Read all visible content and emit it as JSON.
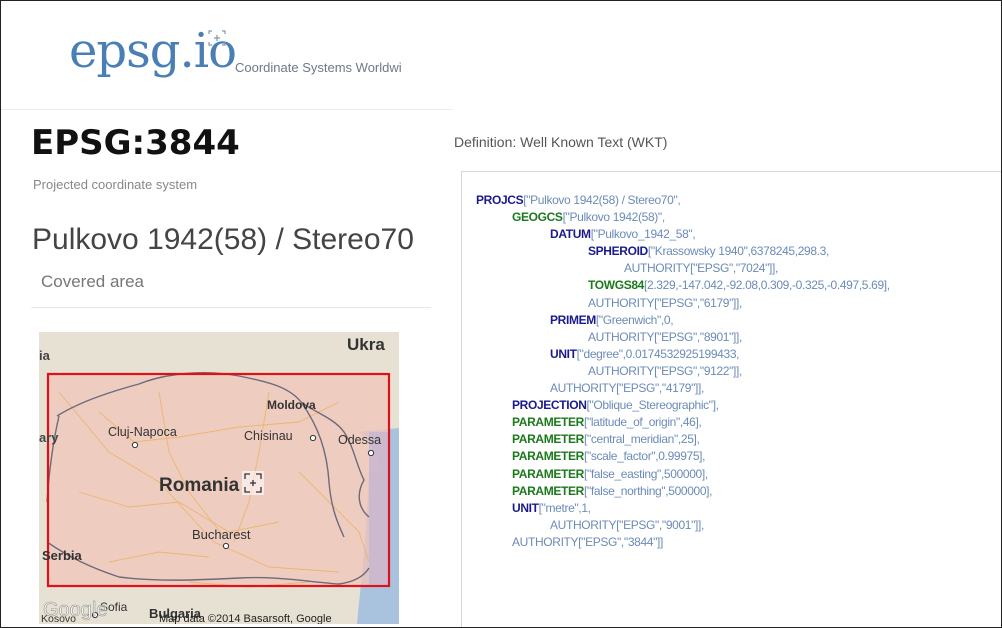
{
  "site": {
    "logo": "epsg.io",
    "tagline": "Coordinate Systems Worldwi"
  },
  "crs": {
    "code": "EPSG:3844",
    "kind": "Projected coordinate system",
    "name": "Pulkovo 1942(58) / Stereo70",
    "covered_area_label": "Covered area"
  },
  "map": {
    "labels": {
      "ukraine": "Ukra",
      "moldova": "Moldova",
      "cluj": "Cluj-Napoca",
      "chisinau": "Chisinau",
      "odessa": "Odessa",
      "romania": "Romania",
      "bucharest": "Bucharest",
      "serbia": "Serbia",
      "sofia": "Sofia",
      "bulgaria": "Bulgaria",
      "kosovo": "Kosovo",
      "left_edge_top": "ia",
      "left_edge_mid": "ary",
      "google": "Google",
      "attribution": "Map data ©2014 Basarsoft, Google"
    },
    "colors": {
      "bbox": "#e0101a",
      "bbox_fill": "#f2c6bd",
      "sea": "#a6c1de"
    }
  },
  "definition": {
    "title": "Definition: Well Known Text (WKT)",
    "lines": [
      {
        "indent": 0,
        "kw": "PROJCS",
        "kwcolor": "navy",
        "rest": "[\"Pulkovo 1942(58) / Stereo70\","
      },
      {
        "indent": 36,
        "kw": "GEOGCS",
        "kwcolor": "green",
        "rest": "[\"Pulkovo 1942(58)\","
      },
      {
        "indent": 74,
        "kw": "DATUM",
        "kwcolor": "navy",
        "rest": "[\"Pulkovo_1942_58\","
      },
      {
        "indent": 112,
        "kw": "SPHEROID",
        "kwcolor": "navy",
        "rest": "[\"Krassowsky 1940\",6378245,298.3,"
      },
      {
        "indent": 148,
        "kw": "",
        "kwcolor": "",
        "rest": "AUTHORITY[\"EPSG\",\"7024\"]],"
      },
      {
        "indent": 112,
        "kw": "TOWGS84",
        "kwcolor": "green",
        "rest": "[2.329,-147.042,-92.08,0.309,-0.325,-0.497,5.69],"
      },
      {
        "indent": 112,
        "kw": "",
        "kwcolor": "",
        "rest": "AUTHORITY[\"EPSG\",\"6179\"]],"
      },
      {
        "indent": 74,
        "kw": "PRIMEM",
        "kwcolor": "navy",
        "rest": "[\"Greenwich\",0,"
      },
      {
        "indent": 112,
        "kw": "",
        "kwcolor": "",
        "rest": "AUTHORITY[\"EPSG\",\"8901\"]],"
      },
      {
        "indent": 74,
        "kw": "UNIT",
        "kwcolor": "navy",
        "rest": "[\"degree\",0.0174532925199433,"
      },
      {
        "indent": 112,
        "kw": "",
        "kwcolor": "",
        "rest": "AUTHORITY[\"EPSG\",\"9122\"]],"
      },
      {
        "indent": 74,
        "kw": "",
        "kwcolor": "",
        "rest": "AUTHORITY[\"EPSG\",\"4179\"]],"
      },
      {
        "indent": 36,
        "kw": "PROJECTION",
        "kwcolor": "navy",
        "rest": "[\"Oblique_Stereographic\"],"
      },
      {
        "indent": 36,
        "kw": "PARAMETER",
        "kwcolor": "green",
        "rest": "[\"latitude_of_origin\",46],"
      },
      {
        "indent": 36,
        "kw": "PARAMETER",
        "kwcolor": "green",
        "rest": "[\"central_meridian\",25],"
      },
      {
        "indent": 36,
        "kw": "PARAMETER",
        "kwcolor": "green",
        "rest": "[\"scale_factor\",0.99975],"
      },
      {
        "indent": 36,
        "kw": "PARAMETER",
        "kwcolor": "green",
        "rest": "[\"false_easting\",500000],"
      },
      {
        "indent": 36,
        "kw": "PARAMETER",
        "kwcolor": "green",
        "rest": "[\"false_northing\",500000],"
      },
      {
        "indent": 36,
        "kw": "UNIT",
        "kwcolor": "navy",
        "rest": "[\"metre\",1,"
      },
      {
        "indent": 74,
        "kw": "",
        "kwcolor": "",
        "rest": "AUTHORITY[\"EPSG\",\"9001\"]],"
      },
      {
        "indent": 36,
        "kw": "",
        "kwcolor": "",
        "rest": "AUTHORITY[\"EPSG\",\"3844\"]]"
      }
    ]
  }
}
